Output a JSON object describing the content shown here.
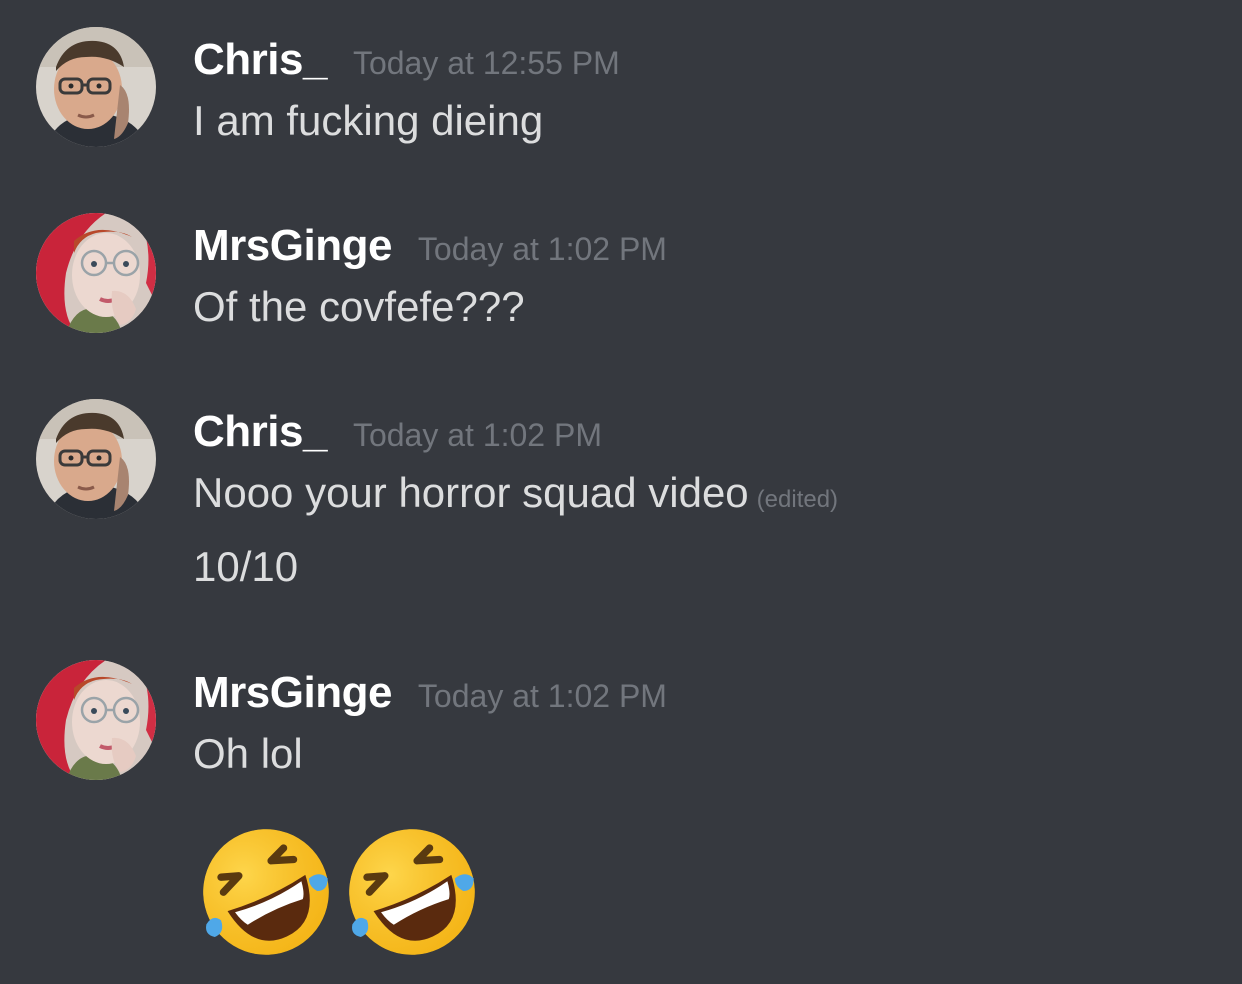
{
  "messages": [
    {
      "author": "Chris_",
      "avatar_icon": "chris-avatar",
      "timestamp": "Today at 12:55 PM",
      "lines": [
        "I am fucking dieing"
      ]
    },
    {
      "author": "MrsGinge",
      "avatar_icon": "mrsginge-avatar",
      "timestamp": "Today at 1:02 PM",
      "lines": [
        "Of the covfefe???"
      ]
    },
    {
      "author": "Chris_",
      "avatar_icon": "chris-avatar",
      "timestamp": "Today at 1:02 PM",
      "lines": [
        "Nooo your horror squad video",
        "10/10"
      ],
      "edited_label": "(edited)"
    },
    {
      "author": "MrsGinge",
      "avatar_icon": "mrsginge-avatar",
      "timestamp": "Today at 1:02 PM",
      "lines": [
        "Oh lol"
      ],
      "emoji": [
        "rolling-on-floor-laughing-emoji",
        "rolling-on-floor-laughing-emoji"
      ]
    }
  ],
  "colors": {
    "background": "#36393f",
    "username": "#ffffff",
    "timestamp": "#72767d",
    "message_text": "#dcddde"
  }
}
